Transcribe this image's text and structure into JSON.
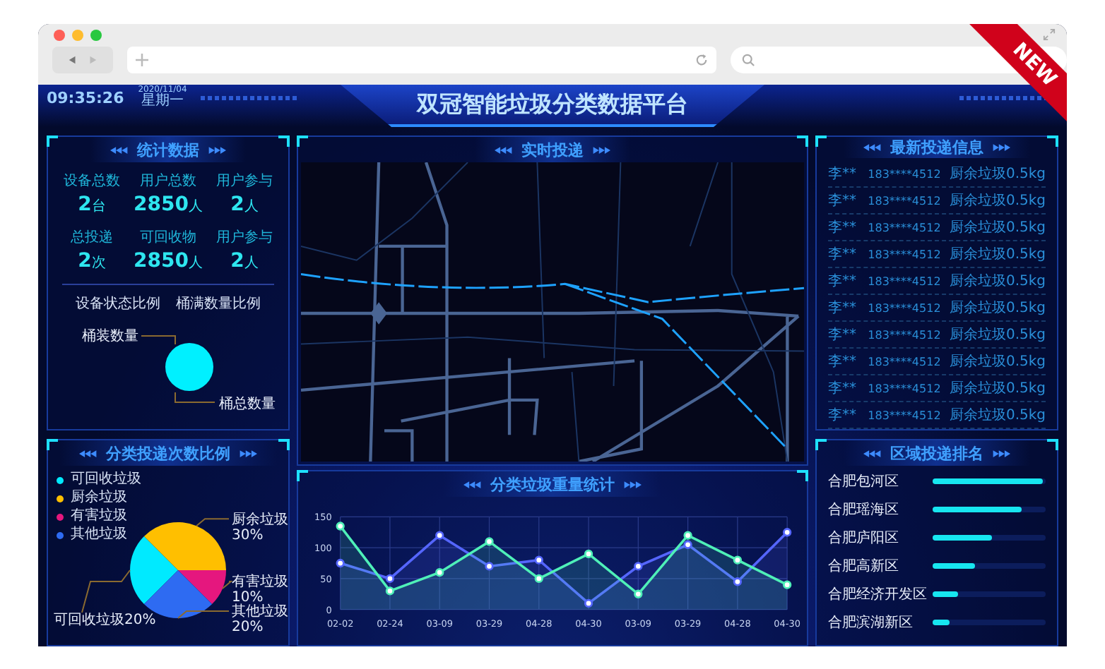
{
  "browser": {
    "new_badge": "NEW"
  },
  "header": {
    "time": "09:35:26",
    "date": "2020/11/04",
    "weekday": "星期一",
    "title": "双冠智能垃圾分类数据平台"
  },
  "stats_panel": {
    "title": "统计数据",
    "stats": [
      {
        "label": "设备总数",
        "value": "2",
        "unit": "台"
      },
      {
        "label": "用户总数",
        "value": "2850",
        "unit": "人"
      },
      {
        "label": "用户参与",
        "value": "2",
        "unit": "人"
      },
      {
        "label": "总投递",
        "value": "2",
        "unit": "次"
      },
      {
        "label": "可回收物",
        "value": "2850",
        "unit": "人"
      },
      {
        "label": "用户参与",
        "value": "2",
        "unit": "人"
      }
    ],
    "status_title": "设备状态比例",
    "bin_title": "桶满数量比例",
    "bin_labels": [
      "桶装数量",
      "桶总数量"
    ]
  },
  "map_panel": {
    "title": "实时投递"
  },
  "latest_panel": {
    "title": "最新投递信息",
    "rows": [
      {
        "name": "李**",
        "phone": "183****4512",
        "detail": "厨余垃圾0.5kg"
      },
      {
        "name": "李**",
        "phone": "183****4512",
        "detail": "厨余垃圾0.5kg"
      },
      {
        "name": "李**",
        "phone": "183****4512",
        "detail": "厨余垃圾0.5kg"
      },
      {
        "name": "李**",
        "phone": "183****4512",
        "detail": "厨余垃圾0.5kg"
      },
      {
        "name": "李**",
        "phone": "183****4512",
        "detail": "厨余垃圾0.5kg"
      },
      {
        "name": "李**",
        "phone": "183****4512",
        "detail": "厨余垃圾0.5kg"
      },
      {
        "name": "李**",
        "phone": "183****4512",
        "detail": "厨余垃圾0.5kg"
      },
      {
        "name": "李**",
        "phone": "183****4512",
        "detail": "厨余垃圾0.5kg"
      },
      {
        "name": "李**",
        "phone": "183****4512",
        "detail": "厨余垃圾0.5kg"
      },
      {
        "name": "李**",
        "phone": "183****4512",
        "detail": "厨余垃圾0.5kg"
      }
    ]
  },
  "category_panel": {
    "title": "分类投递次数比例",
    "chart_data": {
      "type": "pie",
      "categories": [
        "可回收垃圾",
        "厨余垃圾",
        "有害垃圾",
        "其他垃圾"
      ],
      "values": [
        20,
        30,
        10,
        20
      ],
      "colors": [
        "#00eaff",
        "#ffbf00",
        "#e5177e",
        "#2e6bf2"
      ],
      "legend": "upper left",
      "data_labels": true,
      "value_labels": [
        "可回收垃圾20%",
        "厨余垃圾30%",
        "有害垃圾10%",
        "其他垃圾20%"
      ]
    }
  },
  "weight_panel": {
    "title": "分类垃圾重量统计",
    "chart_data": {
      "type": "area",
      "categories": [
        "02-02",
        "02-24",
        "03-09",
        "03-29",
        "04-28",
        "04-30",
        "03-09",
        "03-29",
        "04-28",
        "04-30"
      ],
      "ylim": [
        0,
        150
      ],
      "yticks": [
        0,
        50,
        100,
        150
      ],
      "grid": true,
      "series": [
        {
          "color": "#5566ff",
          "marker": true,
          "values": [
            75,
            50,
            120,
            70,
            80,
            10,
            70,
            105,
            45,
            125
          ]
        },
        {
          "color": "#4ff0b8",
          "marker": true,
          "values": [
            135,
            30,
            60,
            110,
            50,
            90,
            25,
            120,
            80,
            40
          ]
        }
      ]
    }
  },
  "region_panel": {
    "title": "区域投递排名",
    "regions": [
      {
        "name": "合肥包河区",
        "level": 0.97
      },
      {
        "name": "合肥瑶海区",
        "level": 0.79
      },
      {
        "name": "合肥庐阳区",
        "level": 0.53
      },
      {
        "name": "合肥高新区",
        "level": 0.38
      },
      {
        "name": "合肥经济开发区",
        "level": 0.23
      },
      {
        "name": "合肥滨湖新区",
        "level": 0.15
      }
    ]
  }
}
